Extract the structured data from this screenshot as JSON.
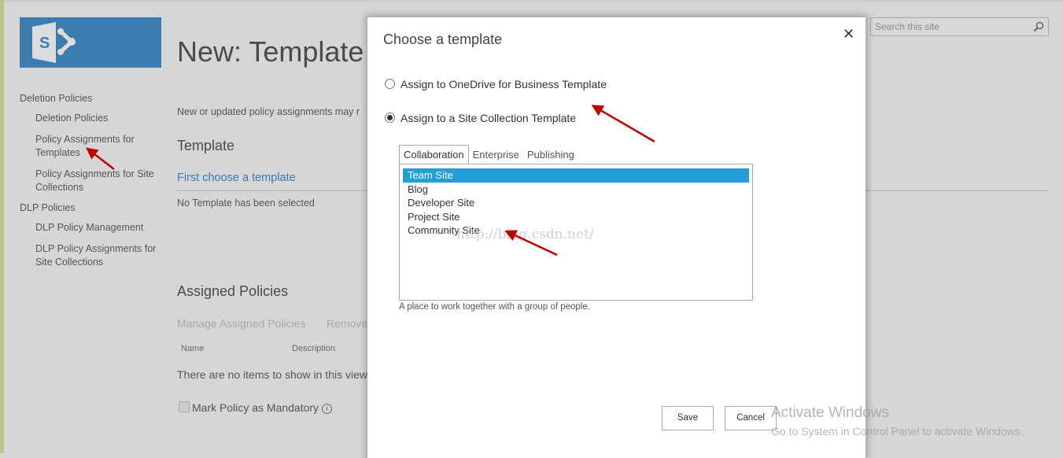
{
  "site": {
    "page_title": "New: Template Assignment",
    "search_placeholder": "Search this site",
    "colors": {
      "brand": "#3c7db1",
      "link": "#3b7ab5",
      "selection": "#229fd9"
    }
  },
  "sidebar": {
    "groups": [
      {
        "label": "Deletion Policies",
        "items": [
          "Deletion Policies",
          "Policy Assignments for Templates",
          "Policy Assignments for Site Collections"
        ]
      },
      {
        "label": "DLP Policies",
        "items": [
          "DLP Policy Management",
          "DLP Policy Assignments for Site Collections"
        ]
      }
    ]
  },
  "main": {
    "notice": "New or updated policy assignments may r",
    "template_heading": "Template",
    "choose_link": "First choose a template",
    "no_template": "No Template has been selected",
    "assigned_heading": "Assigned Policies",
    "manage_link": "Manage Assigned Policies",
    "remove_link": "Remove",
    "columns": [
      "Name",
      "Description"
    ],
    "empty_text": "There are no items to show in this view",
    "mandatory_label": "Mark Policy as Mandatory"
  },
  "dialog": {
    "title": "Choose a template",
    "options": [
      {
        "label": "Assign to OneDrive for Business Template",
        "selected": false
      },
      {
        "label": "Assign to a Site Collection Template",
        "selected": true
      }
    ],
    "tabs": [
      "Collaboration",
      "Enterprise",
      "Publishing"
    ],
    "active_tab": "Collaboration",
    "templates": [
      "Team Site",
      "Blog",
      "Developer Site",
      "Project Site",
      "Community Site"
    ],
    "selected_template": "Team Site",
    "description": "A place to work together with a group of people.",
    "save_label": "Save",
    "cancel_label": "Cancel"
  },
  "overlay": {
    "watermark": "http://blog.csdn.net/",
    "activate_title": "Activate Windows",
    "activate_sub": "Go to System in Control Panel to activate Windows."
  }
}
